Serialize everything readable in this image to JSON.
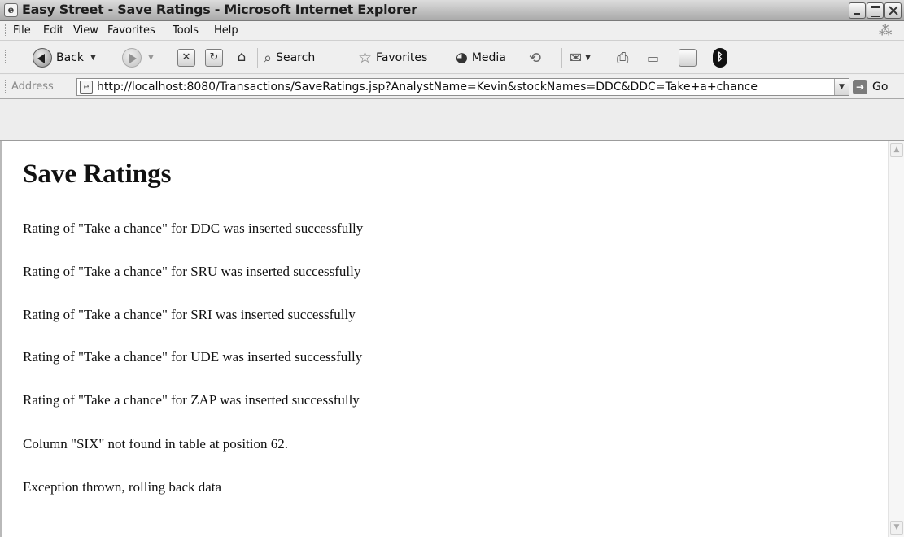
{
  "window": {
    "title": "Easy Street - Save Ratings - Microsoft Internet Explorer"
  },
  "menu": [
    "File",
    "Edit",
    "View",
    "Favorites",
    "Tools",
    "Help"
  ],
  "toolbar": {
    "back_label": "Back",
    "search_label": "Search",
    "favorites_label": "Favorites",
    "media_label": "Media"
  },
  "address": {
    "label": "Address",
    "url": "http://localhost:8080/Transactions/SaveRatings.jsp?AnalystName=Kevin&stockNames=DDC&DDC=Take+a+chance",
    "go_label": "Go"
  },
  "page": {
    "heading": "Save Ratings",
    "messages": [
      "Rating of \"Take a chance\" for DDC was inserted successfully",
      "Rating of \"Take a chance\" for SRU was inserted successfully",
      "Rating of \"Take a chance\" for SRI was inserted successfully",
      "Rating of \"Take a chance\" for UDE was inserted successfully",
      "Rating of \"Take a chance\" for ZAP was inserted successfully",
      "Column \"SIX\" not found in table at position 62.",
      "Exception thrown, rolling back data"
    ]
  }
}
